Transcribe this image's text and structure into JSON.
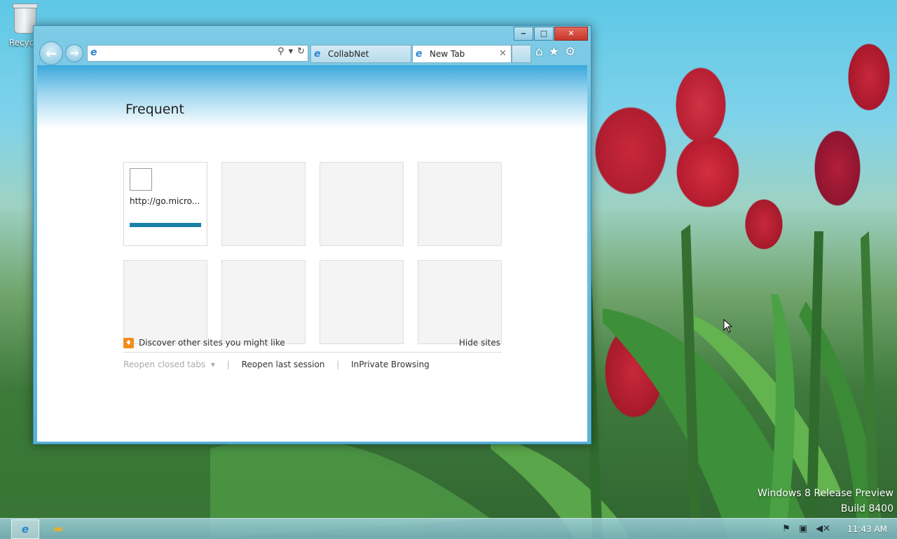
{
  "desktop": {
    "recycle_bin_label": "Recycle",
    "watermark_line1": "Windows 8 Release Preview",
    "watermark_line2": "Build 8400"
  },
  "browser": {
    "window_controls": {
      "minimize": "‒",
      "maximize": "□",
      "close": "✕"
    },
    "address": {
      "value": "",
      "placeholder": ""
    },
    "tabs": [
      {
        "label": "CollabNet",
        "active": false
      },
      {
        "label": "New Tab",
        "active": true
      }
    ],
    "tab_close": "✕",
    "toolbar_icons": [
      "home-icon",
      "favorites-star-icon",
      "settings-gear-icon"
    ]
  },
  "new_tab_page": {
    "title": "Frequent",
    "tiles": [
      {
        "url": "http://go.micro..."
      },
      {
        "url": ""
      },
      {
        "url": ""
      },
      {
        "url": ""
      },
      {
        "url": ""
      },
      {
        "url": ""
      },
      {
        "url": ""
      },
      {
        "url": ""
      }
    ],
    "discover_text": "Discover other sites you might like",
    "hide_sites": "Hide sites",
    "reopen_closed_tabs": "Reopen closed tabs",
    "reopen_last_session": "Reopen last session",
    "inprivate": "InPrivate Browsing"
  },
  "taskbar": {
    "clock": "11:43 AM"
  },
  "colors": {
    "tile_bar": "#1a7fa6",
    "accent": "#3ba8dc"
  }
}
